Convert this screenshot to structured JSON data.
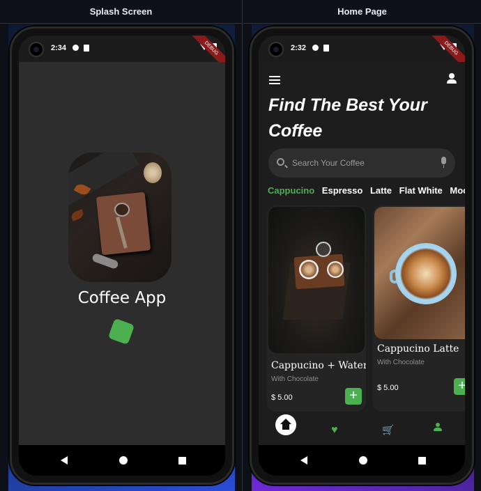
{
  "panels": {
    "left_title": "Splash Screen",
    "right_title": "Home Page"
  },
  "splash": {
    "time": "2:34",
    "debug_banner": "DEBUG",
    "app_title": "Coffee App"
  },
  "home": {
    "time": "2:32",
    "debug_banner": "DEBUG",
    "title": "Find The Best Your Coffee",
    "search_placeholder": "Search Your Coffee",
    "categories": [
      "Cappucino",
      "Espresso",
      "Latte",
      "Flat White",
      "Mocha"
    ],
    "products": [
      {
        "name": "Cappucino + Water",
        "subtitle": "With Chocolate",
        "price": "$ 5.00",
        "add": "+"
      },
      {
        "name": "Cappucino Latte",
        "subtitle": "With Chocolate",
        "price": "$ 5.00",
        "add": "+"
      }
    ],
    "bottom_nav": {
      "heart": "♥",
      "cart": "🛒"
    }
  },
  "colors": {
    "accent": "#4caf50",
    "background": "#1d1d1d",
    "splash_background": "#2d2d2d"
  },
  "icons": [
    "camera-icon",
    "wifi-icon",
    "battery-icon",
    "menu-icon",
    "profile-icon",
    "search-icon",
    "mic-icon",
    "home-icon",
    "heart-icon",
    "cart-icon",
    "person-icon",
    "back-icon",
    "home-nav-icon",
    "recent-apps-icon"
  ]
}
